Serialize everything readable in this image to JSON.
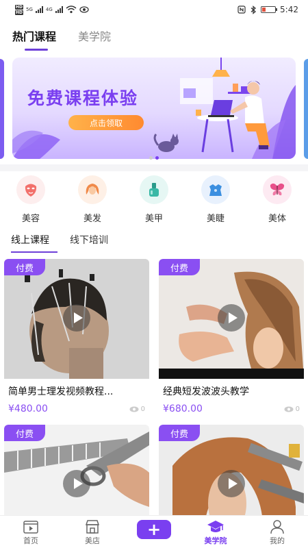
{
  "status_bar": {
    "hd1": "HD",
    "hd2": "HD",
    "network": "5G",
    "network2": "4G",
    "time": "5:42",
    "battery_level": 0.25
  },
  "top_tabs": [
    {
      "label": "热门课程",
      "active": true
    },
    {
      "label": "美学院",
      "active": false
    }
  ],
  "banner": {
    "title": "免费课程体验",
    "button": "点击领取",
    "slide_count": 2,
    "active_slide": 1
  },
  "categories": [
    {
      "label": "美容",
      "icon": "face-mask-icon",
      "color": "#f2706b"
    },
    {
      "label": "美发",
      "icon": "hair-icon",
      "color": "#f08a4a"
    },
    {
      "label": "美甲",
      "icon": "nail-polish-icon",
      "color": "#3ab8a6"
    },
    {
      "label": "美睫",
      "icon": "eyelash-icon",
      "color": "#3b8fe0"
    },
    {
      "label": "美体",
      "icon": "butterfly-icon",
      "color": "#e8508a"
    }
  ],
  "sub_tabs": [
    {
      "label": "线上课程",
      "active": true
    },
    {
      "label": "线下培训",
      "active": false
    }
  ],
  "courses": [
    {
      "badge": "付费",
      "title": "简单男士理发视频教程...",
      "price": "¥480.00",
      "views": "0"
    },
    {
      "badge": "付费",
      "title": "经典短发波波头教学",
      "price": "¥680.00",
      "views": "0"
    },
    {
      "badge": "付费",
      "title": "",
      "price": "",
      "views": ""
    },
    {
      "badge": "付费",
      "title": "",
      "price": "",
      "views": ""
    }
  ],
  "bottom_nav": [
    {
      "label": "首页",
      "icon": "video-icon",
      "active": false
    },
    {
      "label": "美店",
      "icon": "shop-icon",
      "active": false
    },
    {
      "label": "+",
      "icon": "plus-icon",
      "active": false
    },
    {
      "label": "美学院",
      "icon": "graduation-cap-icon",
      "active": true
    },
    {
      "label": "我的",
      "icon": "user-icon",
      "active": false
    }
  ],
  "colors": {
    "accent": "#7a3ff0",
    "badge": "#8a4ff2"
  }
}
